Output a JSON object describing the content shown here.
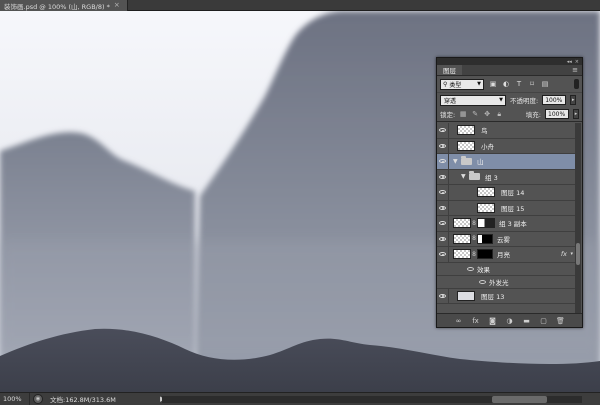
{
  "document_tab": {
    "title": "装饰画.psd @ 100% (山, RGB/8) *",
    "close": "×"
  },
  "status_bar": {
    "zoom": "100%",
    "doc_info": "文档:162.8M/313.6M",
    "arrow": "▶"
  },
  "colors": {
    "sky_top": "#f5f6fa",
    "sky_haze": "#c4c8d4",
    "mountain_far": "#868c9a",
    "mountain_mid": "#5f6474",
    "mountain_near": "#40434f",
    "panel_bg": "#535353",
    "selected_layer": "#7f8ea8"
  },
  "layers_panel": {
    "tab_label": "图层",
    "collapse_glyph": "◂◂",
    "close_glyph": "×",
    "menu_glyph": "≡",
    "filter": {
      "label": "类型",
      "icons": [
        "image-filter-icon",
        "adjustment-filter-icon",
        "type-filter-icon",
        "shape-filter-icon",
        "smart-object-filter-icon"
      ]
    },
    "blend_mode": "穿透",
    "opacity_label": "不透明度:",
    "opacity_value": "100%",
    "lock_label": "锁定:",
    "fill_label": "填充:",
    "fill_value": "100%",
    "layers": [
      {
        "name": "鸟",
        "kind": "layer"
      },
      {
        "name": "小舟",
        "kind": "layer"
      },
      {
        "name": "山",
        "kind": "group",
        "expanded": true,
        "selected": true
      },
      {
        "name": "组 3",
        "kind": "subgroup",
        "expanded": true
      },
      {
        "name": "图层 14",
        "kind": "sublayer"
      },
      {
        "name": "图层 15",
        "kind": "sublayer"
      },
      {
        "name": "组 3 副本",
        "kind": "masked"
      },
      {
        "name": "云雾",
        "kind": "masked"
      },
      {
        "name": "月亮",
        "kind": "masked-fx"
      },
      {
        "name": "效果",
        "kind": "effects"
      },
      {
        "name": "外发光",
        "kind": "effect"
      },
      {
        "name": "图层 13",
        "kind": "solid"
      }
    ],
    "fx_label": "fx",
    "bottom_icons": [
      "link-icon",
      "fx-icon",
      "mask-icon",
      "adjustment-icon",
      "folder-icon",
      "new-layer-icon",
      "trash-icon"
    ]
  }
}
